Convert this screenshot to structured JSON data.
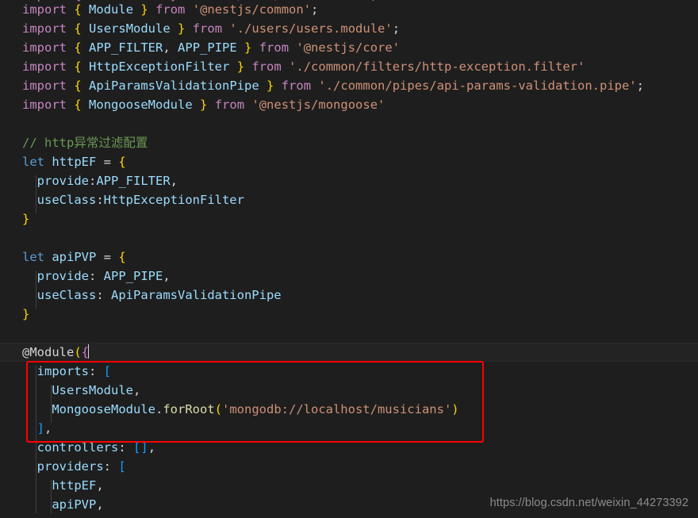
{
  "editor": {
    "language": "typescript",
    "theme": "dark-plus",
    "background": "#1e1e1e",
    "cut_off_top_line": "import { CatsModule } from './cats/cats.module';",
    "current_line_number": 16,
    "caret_after": "@Module({"
  },
  "colors": {
    "keyword": "#C586C0",
    "control": "#569CD6",
    "identifier": "#9CDCFE",
    "string": "#CE9178",
    "comment": "#6A9955",
    "function": "#DCDCAA",
    "punctuation": "#D4D4D4",
    "bracket_level_1": "#FFD700",
    "bracket_level_2": "#DA70D6",
    "bracket_level_3": "#179FFF",
    "annotation_box": "#FF0000",
    "current_line_bg": "#232323",
    "indent_guide": "#404040",
    "watermark": "#8C8C8C"
  },
  "code": {
    "lines": [
      {
        "n": 1,
        "tokens": [
          {
            "t": "import",
            "c": "kw"
          },
          {
            "t": " ",
            "c": "punc"
          },
          {
            "t": "{",
            "c": "br1"
          },
          {
            "t": " ",
            "c": "punc"
          },
          {
            "t": "Module",
            "c": "ident"
          },
          {
            "t": " ",
            "c": "punc"
          },
          {
            "t": "}",
            "c": "br1"
          },
          {
            "t": " ",
            "c": "punc"
          },
          {
            "t": "from",
            "c": "kw"
          },
          {
            "t": " ",
            "c": "punc"
          },
          {
            "t": "'@nestjs/common'",
            "c": "str"
          },
          {
            "t": ";",
            "c": "punc"
          }
        ]
      },
      {
        "n": 2,
        "tokens": [
          {
            "t": "import",
            "c": "kw"
          },
          {
            "t": " ",
            "c": "punc"
          },
          {
            "t": "{",
            "c": "br1"
          },
          {
            "t": " ",
            "c": "punc"
          },
          {
            "t": "UsersModule",
            "c": "ident"
          },
          {
            "t": " ",
            "c": "punc"
          },
          {
            "t": "}",
            "c": "br1"
          },
          {
            "t": " ",
            "c": "punc"
          },
          {
            "t": "from",
            "c": "kw"
          },
          {
            "t": " ",
            "c": "punc"
          },
          {
            "t": "'./users/users.module'",
            "c": "str"
          },
          {
            "t": ";",
            "c": "punc"
          }
        ]
      },
      {
        "n": 3,
        "tokens": [
          {
            "t": "import",
            "c": "kw"
          },
          {
            "t": " ",
            "c": "punc"
          },
          {
            "t": "{",
            "c": "br1"
          },
          {
            "t": " ",
            "c": "punc"
          },
          {
            "t": "APP_FILTER",
            "c": "ident"
          },
          {
            "t": ", ",
            "c": "punc"
          },
          {
            "t": "APP_PIPE",
            "c": "ident"
          },
          {
            "t": " ",
            "c": "punc"
          },
          {
            "t": "}",
            "c": "br1"
          },
          {
            "t": " ",
            "c": "punc"
          },
          {
            "t": "from",
            "c": "kw"
          },
          {
            "t": " ",
            "c": "punc"
          },
          {
            "t": "'@nestjs/core'",
            "c": "str"
          }
        ]
      },
      {
        "n": 4,
        "tokens": [
          {
            "t": "import",
            "c": "kw"
          },
          {
            "t": " ",
            "c": "punc"
          },
          {
            "t": "{",
            "c": "br1"
          },
          {
            "t": " ",
            "c": "punc"
          },
          {
            "t": "HttpExceptionFilter",
            "c": "ident"
          },
          {
            "t": " ",
            "c": "punc"
          },
          {
            "t": "}",
            "c": "br1"
          },
          {
            "t": " ",
            "c": "punc"
          },
          {
            "t": "from",
            "c": "kw"
          },
          {
            "t": " ",
            "c": "punc"
          },
          {
            "t": "'./common/filters/http-exception.filter'",
            "c": "str"
          }
        ]
      },
      {
        "n": 5,
        "tokens": [
          {
            "t": "import",
            "c": "kw"
          },
          {
            "t": " ",
            "c": "punc"
          },
          {
            "t": "{",
            "c": "br1"
          },
          {
            "t": " ",
            "c": "punc"
          },
          {
            "t": "ApiParamsValidationPipe",
            "c": "ident"
          },
          {
            "t": " ",
            "c": "punc"
          },
          {
            "t": "}",
            "c": "br1"
          },
          {
            "t": " ",
            "c": "punc"
          },
          {
            "t": "from",
            "c": "kw"
          },
          {
            "t": " ",
            "c": "punc"
          },
          {
            "t": "'./common/pipes/api-params-validation.pipe'",
            "c": "str"
          },
          {
            "t": ";",
            "c": "punc"
          }
        ]
      },
      {
        "n": 6,
        "tokens": [
          {
            "t": "import",
            "c": "kw"
          },
          {
            "t": " ",
            "c": "punc"
          },
          {
            "t": "{",
            "c": "br1"
          },
          {
            "t": " ",
            "c": "punc"
          },
          {
            "t": "MongooseModule",
            "c": "ident"
          },
          {
            "t": " ",
            "c": "punc"
          },
          {
            "t": "}",
            "c": "br1"
          },
          {
            "t": " ",
            "c": "punc"
          },
          {
            "t": "from",
            "c": "kw"
          },
          {
            "t": " ",
            "c": "punc"
          },
          {
            "t": "'@nestjs/mongoose'",
            "c": "str"
          }
        ]
      },
      {
        "n": 7,
        "tokens": []
      },
      {
        "n": 8,
        "tokens": [
          {
            "t": "// http异常过滤配置",
            "c": "cmt"
          }
        ]
      },
      {
        "n": 9,
        "tokens": [
          {
            "t": "let",
            "c": "ctrl"
          },
          {
            "t": " ",
            "c": "punc"
          },
          {
            "t": "httpEF",
            "c": "ident"
          },
          {
            "t": " = ",
            "c": "punc"
          },
          {
            "t": "{",
            "c": "br1"
          }
        ]
      },
      {
        "n": 10,
        "tokens": [
          {
            "t": "  ",
            "c": "punc"
          },
          {
            "t": "provide",
            "c": "ident"
          },
          {
            "t": ":",
            "c": "punc"
          },
          {
            "t": "APP_FILTER",
            "c": "ident"
          },
          {
            "t": ",",
            "c": "punc"
          }
        ]
      },
      {
        "n": 11,
        "tokens": [
          {
            "t": "  ",
            "c": "punc"
          },
          {
            "t": "useClass",
            "c": "ident"
          },
          {
            "t": ":",
            "c": "punc"
          },
          {
            "t": "HttpExceptionFilter",
            "c": "ident"
          }
        ]
      },
      {
        "n": 12,
        "tokens": [
          {
            "t": "}",
            "c": "br1"
          }
        ]
      },
      {
        "n": 13,
        "tokens": []
      },
      {
        "n": 14,
        "tokens": [
          {
            "t": "let",
            "c": "ctrl"
          },
          {
            "t": " ",
            "c": "punc"
          },
          {
            "t": "apiPVP",
            "c": "ident"
          },
          {
            "t": " = ",
            "c": "punc"
          },
          {
            "t": "{",
            "c": "br1"
          }
        ]
      },
      {
        "n": 15,
        "tokens": [
          {
            "t": "  ",
            "c": "punc"
          },
          {
            "t": "provide",
            "c": "ident"
          },
          {
            "t": ": ",
            "c": "punc"
          },
          {
            "t": "APP_PIPE",
            "c": "ident"
          },
          {
            "t": ",",
            "c": "punc"
          }
        ]
      },
      {
        "n": 16,
        "tokens": [
          {
            "t": "  ",
            "c": "punc"
          },
          {
            "t": "useClass",
            "c": "ident"
          },
          {
            "t": ": ",
            "c": "punc"
          },
          {
            "t": "ApiParamsValidationPipe",
            "c": "ident"
          }
        ]
      },
      {
        "n": 17,
        "tokens": [
          {
            "t": "}",
            "c": "br1"
          }
        ]
      },
      {
        "n": 18,
        "tokens": []
      },
      {
        "n": 19,
        "current": true,
        "caret": true,
        "tokens": [
          {
            "t": "@Module",
            "c": "dec"
          },
          {
            "t": "(",
            "c": "br1"
          },
          {
            "t": "{",
            "c": "br2"
          }
        ]
      },
      {
        "n": 20,
        "tokens": [
          {
            "t": "  ",
            "c": "punc"
          },
          {
            "t": "imports",
            "c": "ident"
          },
          {
            "t": ": ",
            "c": "punc"
          },
          {
            "t": "[",
            "c": "br3"
          }
        ]
      },
      {
        "n": 21,
        "tokens": [
          {
            "t": "    ",
            "c": "punc"
          },
          {
            "t": "UsersModule",
            "c": "ident"
          },
          {
            "t": ",",
            "c": "punc"
          }
        ]
      },
      {
        "n": 22,
        "tokens": [
          {
            "t": "    ",
            "c": "punc"
          },
          {
            "t": "MongooseModule",
            "c": "ident"
          },
          {
            "t": ".",
            "c": "punc"
          },
          {
            "t": "forRoot",
            "c": "fn"
          },
          {
            "t": "(",
            "c": "br1"
          },
          {
            "t": "'mongodb://localhost/musicians'",
            "c": "str"
          },
          {
            "t": ")",
            "c": "br1"
          }
        ]
      },
      {
        "n": 23,
        "tokens": [
          {
            "t": "  ",
            "c": "punc"
          },
          {
            "t": "]",
            "c": "br3"
          },
          {
            "t": ",",
            "c": "punc"
          }
        ]
      },
      {
        "n": 24,
        "tokens": [
          {
            "t": "  ",
            "c": "punc"
          },
          {
            "t": "controllers",
            "c": "ident"
          },
          {
            "t": ": ",
            "c": "punc"
          },
          {
            "t": "[",
            "c": "br3"
          },
          {
            "t": "]",
            "c": "br3"
          },
          {
            "t": ",",
            "c": "punc"
          }
        ]
      },
      {
        "n": 25,
        "tokens": [
          {
            "t": "  ",
            "c": "punc"
          },
          {
            "t": "providers",
            "c": "ident"
          },
          {
            "t": ": ",
            "c": "punc"
          },
          {
            "t": "[",
            "c": "br3"
          }
        ]
      },
      {
        "n": 26,
        "tokens": [
          {
            "t": "    ",
            "c": "punc"
          },
          {
            "t": "httpEF",
            "c": "ident"
          },
          {
            "t": ",",
            "c": "punc"
          }
        ]
      },
      {
        "n": 27,
        "tokens": [
          {
            "t": "    ",
            "c": "punc"
          },
          {
            "t": "apiPVP",
            "c": "ident"
          },
          {
            "t": ",",
            "c": "punc"
          }
        ]
      }
    ]
  },
  "annotation": {
    "type": "rectangle-highlight",
    "color": "#FF0000",
    "covers_lines": "imports: [ ... ],"
  },
  "watermark": {
    "text": "https://blog.csdn.net/weixin_44273392"
  }
}
